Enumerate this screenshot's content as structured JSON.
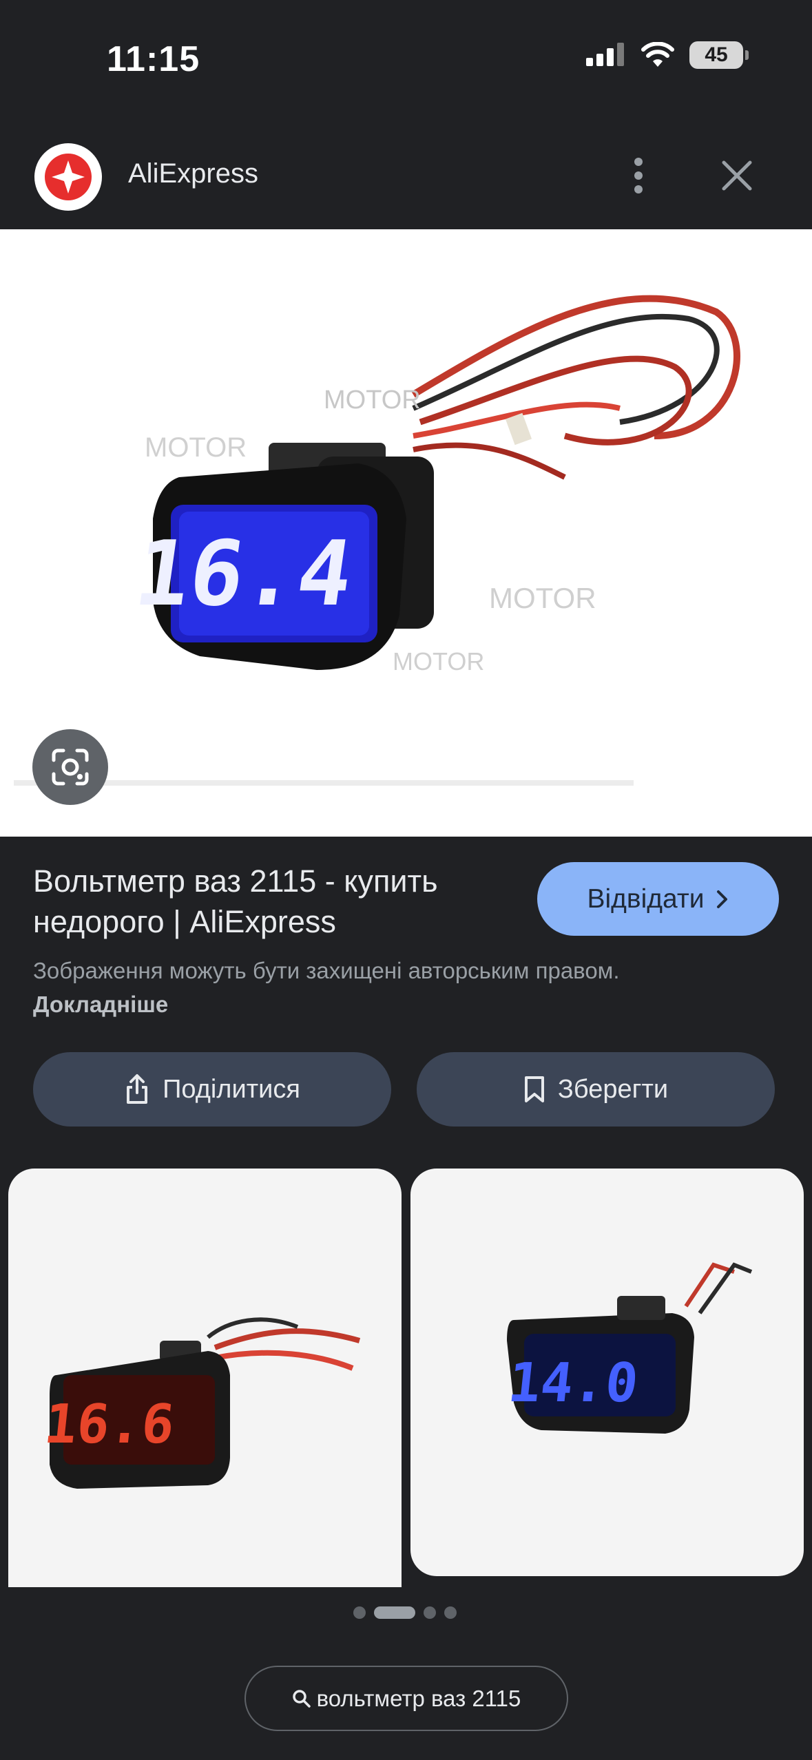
{
  "status_bar": {
    "time": "11:15",
    "battery_level": "45",
    "icons": [
      "cellular-signal-icon",
      "wifi-icon",
      "battery-icon"
    ]
  },
  "header": {
    "site_name": "AliExpress",
    "icons": [
      "aliexpress-logo-icon",
      "more-vert-icon",
      "close-icon"
    ]
  },
  "main_image": {
    "display_value": "16.4"
  },
  "result": {
    "title": "Вольтметр ваз 2115 - купить недорого | AliExpress",
    "visit_label": "Відвідати",
    "copyright_text": "Зображення можуть бути захищені авторським правом.",
    "learn_more": "Докладніше"
  },
  "actions": {
    "share_label": "Поділитися",
    "save_label": "Зберегти"
  },
  "related": [
    {
      "display_value": "16.6",
      "display_color": "#e8452a"
    },
    {
      "display_value": "14.0",
      "display_color": "#3d5bff"
    }
  ],
  "pagination": {
    "total": 4,
    "active": 1
  },
  "query": {
    "text": "вольтметр ваз 2115"
  },
  "colors": {
    "background": "#202124",
    "accent": "#8ab4f8",
    "chip": "#3c4556",
    "brand": "#e62e2d"
  }
}
